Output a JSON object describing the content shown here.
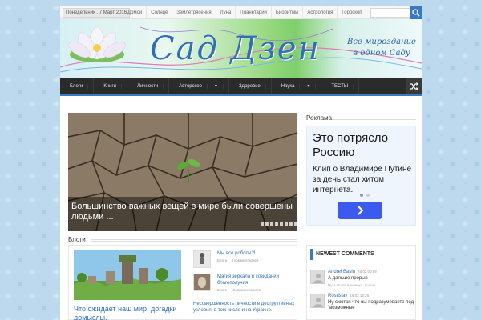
{
  "topbar": {
    "date": "Понедельник , 7 Март 2016",
    "nav": [
      "Домой",
      "Солнце",
      "Землетрясения",
      "Луна",
      "Планетарий",
      "Биоритмы",
      "Астрология",
      "Гороскоп"
    ],
    "search_placeholder": ""
  },
  "header": {
    "site_title": "Сад Дзен",
    "tagline_line1": "Все мироздание",
    "tagline_line2": "в одном Саду"
  },
  "main_nav": {
    "items": [
      {
        "label": "Блоги",
        "dropdown": false
      },
      {
        "label": "Книги",
        "dropdown": false
      },
      {
        "label": "Личности",
        "dropdown": false
      },
      {
        "label": "Авторское",
        "dropdown": true
      },
      {
        "label": "Здоровье",
        "dropdown": false
      },
      {
        "label": "Наука",
        "dropdown": true
      },
      {
        "label": "ТЕСТЫ",
        "dropdown": false
      }
    ],
    "accent_color": "#3a79c4"
  },
  "slider": {
    "caption": "Большинство важных вещей в мире были совершены людьми ..."
  },
  "ad": {
    "heading": "Реклама",
    "title": "Это потрясло Россию",
    "text": "Клип о Владимире Путине за день стал хитом интернета.",
    "button_icon": "chevron-right-icon",
    "button_color": "#3d5aef"
  },
  "blogs": {
    "heading": "Блоги",
    "main_title": "Что ожидает наш мир, догадки домыслы.",
    "items": [
      {
        "title": "Мы все роботы?!",
        "author": "Блоги",
        "comments": "3 комментариев"
      },
      {
        "title": "Магия зеркала в созидании благополучия",
        "author": "Блоги",
        "comments": "15 комментариев"
      }
    ],
    "text": "Несовершенность личности в деструктивных условия, в том числе и на Украине."
  },
  "comments": {
    "title": "NEWEST COMMENTS",
    "items": [
      {
        "author": "Andrei Basin",
        "time": "25.02.00:09",
        "text": "А дальше прорыв",
        "excerpt": "Путь мозга человека, волны ..."
      },
      {
        "author": "Rostislav",
        "time": "16.02.14:26",
        "text": "Ну смотря что вы подразумеваете под \"возможные",
        "excerpt": ""
      }
    ]
  }
}
